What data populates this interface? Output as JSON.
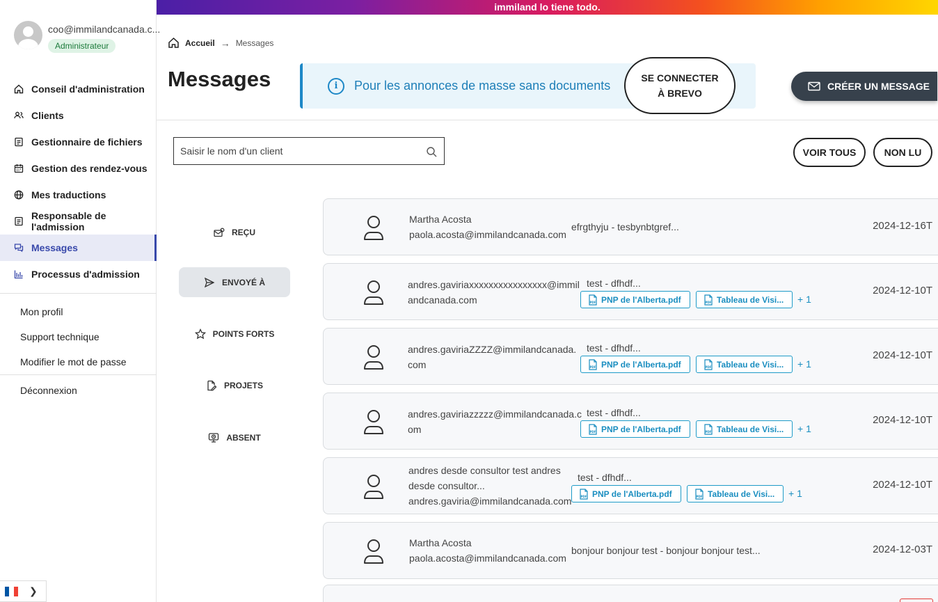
{
  "banner": {
    "text": "immiland lo tiene todo."
  },
  "user": {
    "email": "coo@immilandcanada.c...",
    "role": "Administrateur"
  },
  "nav": {
    "items": [
      {
        "label": "Conseil d'administration",
        "icon": "home-icon"
      },
      {
        "label": "Clients",
        "icon": "users-icon"
      },
      {
        "label": "Gestionnaire de fichiers",
        "icon": "file-icon"
      },
      {
        "label": "Gestion des rendez-vous",
        "icon": "calendar-icon"
      },
      {
        "label": "Mes traductions",
        "icon": "globe-icon"
      },
      {
        "label": "Responsable de l'admission",
        "icon": "file-icon"
      },
      {
        "label": "Messages",
        "icon": "chat-icon",
        "active": true
      },
      {
        "label": "Processus d'admission",
        "icon": "bar-chart-icon"
      }
    ],
    "profile": "Mon profil",
    "support": "Support technique",
    "password": "Modifier le mot de passe",
    "logout": "Déconnexion"
  },
  "lang": {
    "flag_colors": [
      "#0055a4",
      "#ffffff",
      "#ef4135"
    ]
  },
  "breadcrumb": {
    "home": "Accueil",
    "current": "Messages"
  },
  "page": {
    "title": "Messages"
  },
  "info": {
    "text": "Pour les annonces de masse sans documents",
    "button_line1": "SE CONNECTER",
    "button_line2": "À BREVO"
  },
  "create_button": "CRÉER UN MESSAGE",
  "search": {
    "placeholder": "Saisir le nom d'un client"
  },
  "filters": {
    "all": "VOIR TOUS",
    "unread": "NON LU"
  },
  "folders": {
    "received": "REÇU",
    "sent": "ENVOYÉ À",
    "highlights": "POINTS FORTS",
    "projects": "PROJETS",
    "absent": "ABSENT"
  },
  "messages": [
    {
      "sender_line1": "Martha Acosta",
      "sender_line2": "paola.acosta@immilandcanada.com",
      "subject": "efrgthyju - tesbynbtgref...",
      "date": "2024-12-16T"
    },
    {
      "sender_line1": "andres.gaviriaxxxxxxxxxxxxxxxx@immil",
      "sender_line2": "andcanada.com",
      "subject": "test - dfhdf...",
      "att1": "PNP de l'Alberta.pdf",
      "att2": "Tableau de Visi...",
      "more": "+ 1",
      "date": "2024-12-10T"
    },
    {
      "sender_line1": "andres.gaviriaZZZZ@immilandcanada.",
      "sender_line2": "com",
      "subject": "test - dfhdf...",
      "att1": "PNP de l'Alberta.pdf",
      "att2": "Tableau de Visi...",
      "more": "+ 1",
      "date": "2024-12-10T"
    },
    {
      "sender_line1": "andres.gaviriazzzzz@immilandcanada.c",
      "sender_line2": "om",
      "subject": "test - dfhdf...",
      "att1": "PNP de l'Alberta.pdf",
      "att2": "Tableau de Visi...",
      "more": "+ 1",
      "date": "2024-12-10T"
    },
    {
      "sender_line1": "andres desde consultor test andres",
      "sender_line2": "desde consultor...",
      "sender_line3": "andres.gaviria@immilandcanada.com",
      "subject": "test - dfhdf...",
      "att1": "PNP de l'Alberta.pdf",
      "att2": "Tableau de Visi...",
      "more": "+ 1",
      "date": "2024-12-10T"
    },
    {
      "sender_line1": "Martha Acosta",
      "sender_line2": "paola.acosta@immilandcanada.com",
      "subject": "bonjour bonjour test - bonjour bonjour test...",
      "date": "2024-12-03T"
    }
  ]
}
